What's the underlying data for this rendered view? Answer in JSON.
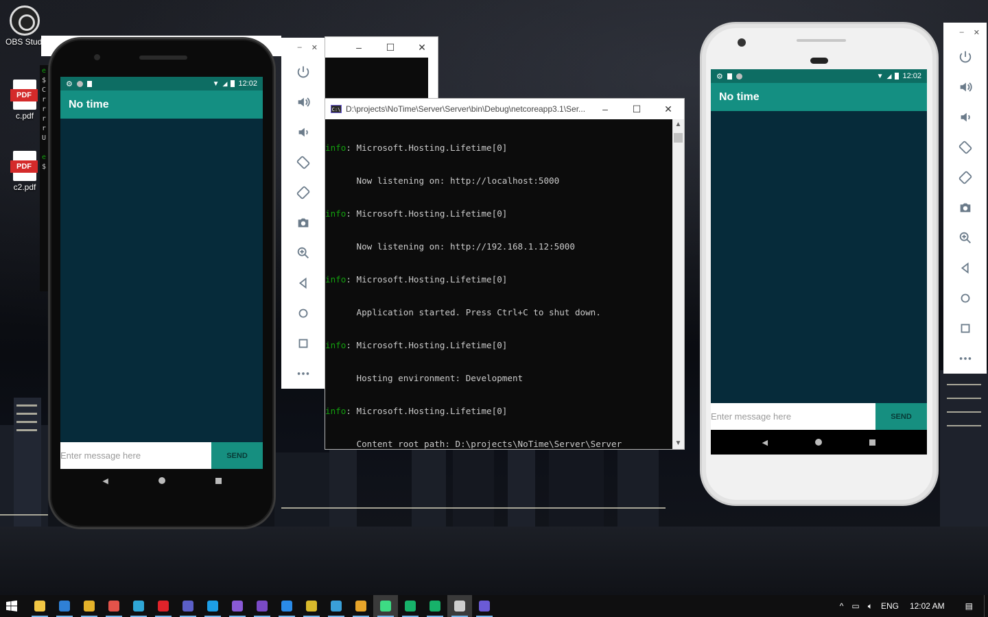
{
  "desktop": {
    "icons": [
      {
        "label": "OBS Studi",
        "icon": "obs-icon"
      },
      {
        "label": "c.pdf",
        "icon": "pdf-icon"
      },
      {
        "label": "c2.pdf",
        "icon": "pdf-icon"
      }
    ],
    "pdf_tag": "PDF",
    "bg_terminal_chars": [
      "e",
      "$",
      "C",
      "r",
      "r",
      "r",
      "r",
      "U",
      "",
      "e",
      "$"
    ]
  },
  "console": {
    "icon_text": "C:\\",
    "title": "D:\\projects\\NoTime\\Server\\Server\\bin\\Debug\\netcoreapp3.1\\Ser...",
    "lines": [
      {
        "level": "info",
        "text": ": Microsoft.Hosting.Lifetime[0]"
      },
      {
        "level": "",
        "text": "      Now listening on: http://localhost:5000"
      },
      {
        "level": "info",
        "text": ": Microsoft.Hosting.Lifetime[0]"
      },
      {
        "level": "",
        "text": "      Now listening on: http://192.168.1.12:5000"
      },
      {
        "level": "info",
        "text": ": Microsoft.Hosting.Lifetime[0]"
      },
      {
        "level": "",
        "text": "      Application started. Press Ctrl+C to shut down."
      },
      {
        "level": "info",
        "text": ": Microsoft.Hosting.Lifetime[0]"
      },
      {
        "level": "",
        "text": "      Hosting environment: Development"
      },
      {
        "level": "info",
        "text": ": Microsoft.Hosting.Lifetime[0]"
      },
      {
        "level": "",
        "text": "      Content root path: D:\\projects\\NoTime\\Server\\Server"
      }
    ]
  },
  "phone_left": {
    "time": "12:02",
    "app_title": "No time",
    "input_placeholder": "Enter message here",
    "send_label": "SEND"
  },
  "phone_right": {
    "time": "12:02",
    "app_title": "No time",
    "input_placeholder": "Enter message here",
    "send_label": "SEND"
  },
  "emulator_toolbar": {
    "tools": [
      "power-icon",
      "volume-up-icon",
      "volume-down-icon",
      "rotate-left-icon",
      "rotate-right-icon",
      "camera-icon",
      "zoom-icon",
      "back-icon",
      "home-icon",
      "overview-icon",
      "more-icon"
    ]
  },
  "taskbar": {
    "items": [
      {
        "icon": "file-explorer-icon",
        "color": "#f2c744"
      },
      {
        "icon": "mail-icon",
        "color": "#2f80d6"
      },
      {
        "icon": "chrome-icon",
        "color": "#e4b22a"
      },
      {
        "icon": "chrome-icon",
        "color": "#e3534a"
      },
      {
        "icon": "edge-icon",
        "color": "#2fa6d6"
      },
      {
        "icon": "opera-icon",
        "color": "#e0232a"
      },
      {
        "icon": "teams-icon",
        "color": "#5b5fc7"
      },
      {
        "icon": "skype-icon",
        "color": "#1d9ee6"
      },
      {
        "icon": "visual-studio-icon",
        "color": "#8a5ad6"
      },
      {
        "icon": "visual-studio-icon",
        "color": "#7a4ac6"
      },
      {
        "icon": "vs-code-icon",
        "color": "#2a8be8"
      },
      {
        "icon": "app-icon",
        "color": "#d8b92c"
      },
      {
        "icon": "app-icon",
        "color": "#3aa0d8"
      },
      {
        "icon": "git-icon",
        "color": "#e8a52a"
      },
      {
        "icon": "android-studio-icon",
        "color": "#3ddc84"
      },
      {
        "icon": "terminal-green-icon",
        "color": "#17b26a"
      },
      {
        "icon": "terminal-green-icon",
        "color": "#17b26a"
      },
      {
        "icon": "obs-icon",
        "color": "#cfcfcf"
      },
      {
        "icon": "console-icon",
        "color": "#6b5bd6"
      }
    ],
    "tray": {
      "language": "ENG",
      "time": "12:02 AM"
    }
  }
}
